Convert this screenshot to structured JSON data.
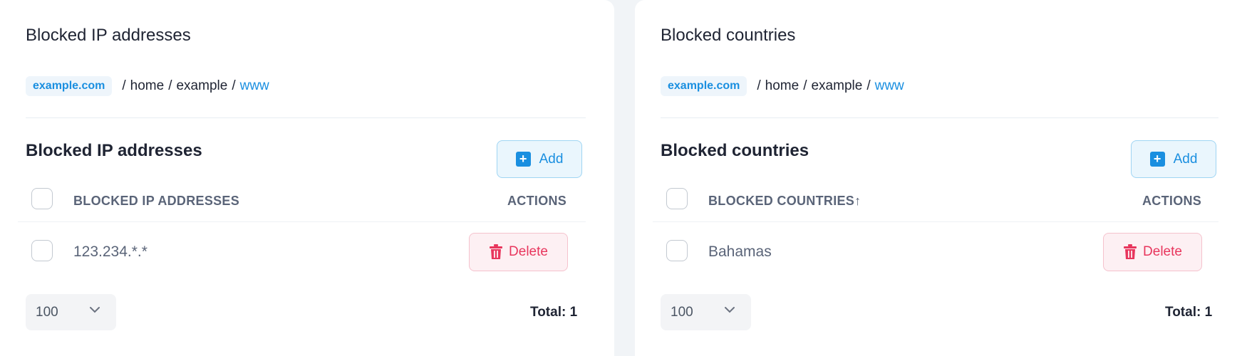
{
  "colors": {
    "accent": "#1a8fe0",
    "danger": "#e8365d",
    "text": "#1f2433",
    "muted": "#5a6478"
  },
  "left_panel": {
    "title": "Blocked IP addresses",
    "breadcrumb": {
      "domain": "example.com",
      "path_1": "home",
      "path_2": "example",
      "path_3": "www"
    },
    "section_title": "Blocked IP addresses",
    "add_label": "Add",
    "column_header": "BLOCKED IP ADDRESSES",
    "actions_header": "ACTIONS",
    "rows": [
      {
        "value": "123.234.*.*",
        "delete_label": "Delete"
      }
    ],
    "page_size": "100",
    "total": "Total: 1"
  },
  "right_panel": {
    "title": "Blocked countries",
    "breadcrumb": {
      "domain": "example.com",
      "path_1": "home",
      "path_2": "example",
      "path_3": "www"
    },
    "section_title": "Blocked countries",
    "add_label": "Add",
    "column_header": "BLOCKED COUNTRIES↑",
    "actions_header": "ACTIONS",
    "rows": [
      {
        "value": "Bahamas",
        "delete_label": "Delete"
      }
    ],
    "page_size": "100",
    "total": "Total: 1"
  }
}
